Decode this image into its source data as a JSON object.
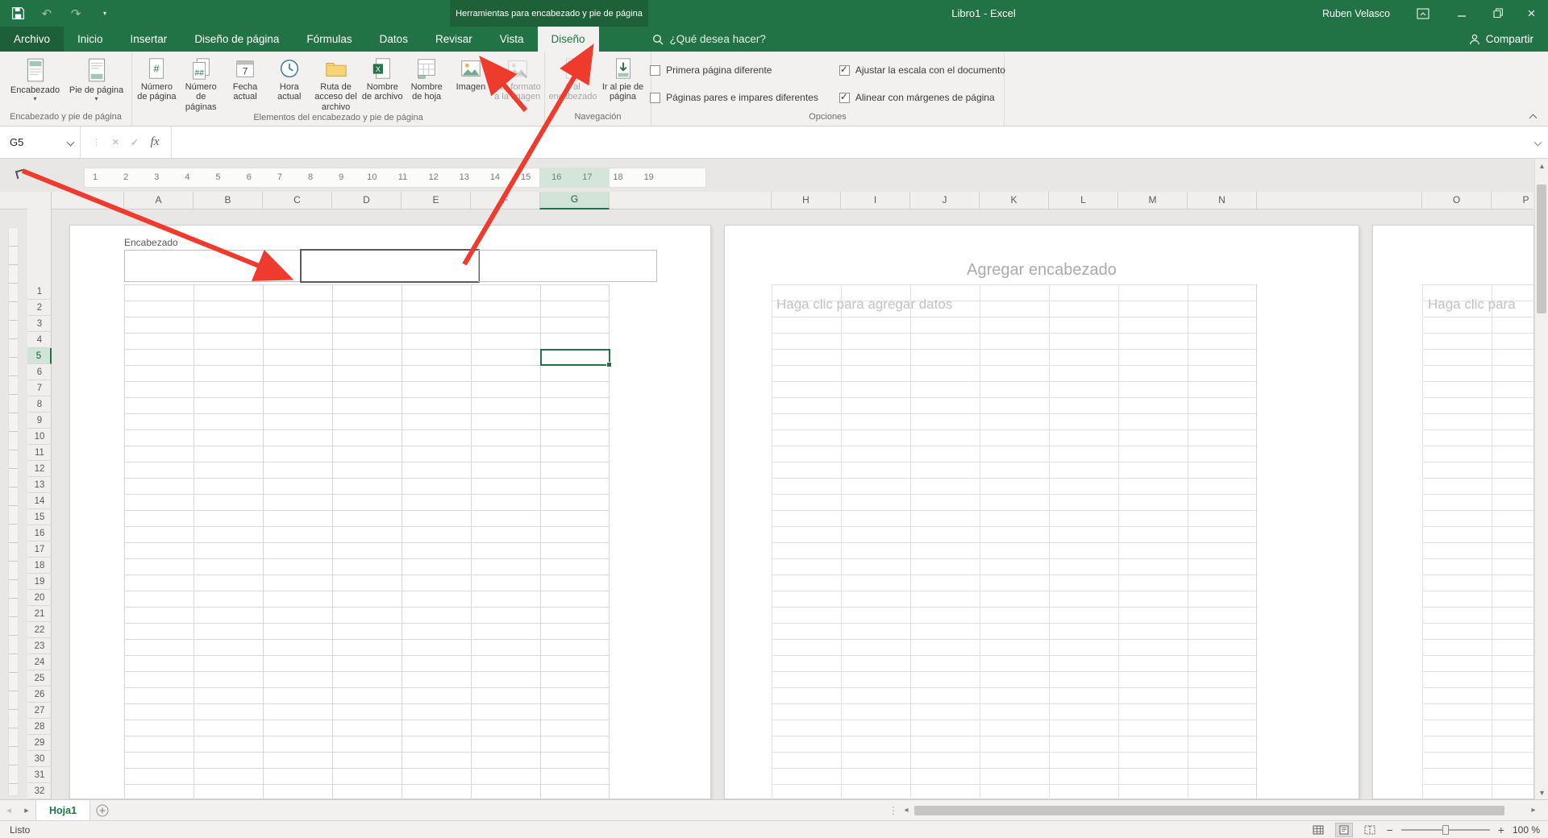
{
  "titlebar": {
    "contextual_title": "Herramientas para encabezado y pie de página",
    "document_title": "Libro1 - Excel",
    "user_name": "Ruben Velasco"
  },
  "tabs": {
    "file": "Archivo",
    "items": [
      "Inicio",
      "Insertar",
      "Diseño de página",
      "Fórmulas",
      "Datos",
      "Revisar",
      "Vista"
    ],
    "contextual": "Diseño",
    "search_text": "¿Qué desea hacer?",
    "share": "Compartir"
  },
  "ribbon": {
    "group1": {
      "title": "Encabezado y pie de página",
      "buttons": [
        {
          "label": "Encabezado",
          "icon": "header-icon"
        },
        {
          "label": "Pie de página",
          "icon": "footer-icon"
        }
      ]
    },
    "group2": {
      "title": "Elementos del encabezado y pie de página",
      "buttons": [
        {
          "label": "Número de página",
          "icon": "page-number-icon",
          "enabled": true
        },
        {
          "label": "Número de páginas",
          "icon": "number-of-pages-icon",
          "enabled": true
        },
        {
          "label": "Fecha actual",
          "icon": "current-date-icon",
          "enabled": true
        },
        {
          "label": "Hora actual",
          "icon": "current-time-icon",
          "enabled": true
        },
        {
          "label": "Ruta de acceso del archivo",
          "icon": "file-path-icon",
          "enabled": true
        },
        {
          "label": "Nombre de archivo",
          "icon": "file-name-icon",
          "enabled": true
        },
        {
          "label": "Nombre de hoja",
          "icon": "sheet-name-icon",
          "enabled": true
        },
        {
          "label": "Imagen",
          "icon": "picture-icon",
          "enabled": true
        },
        {
          "label": "Dar formato a la imagen",
          "icon": "format-picture-icon",
          "enabled": false
        }
      ]
    },
    "group3": {
      "title": "Navegación",
      "buttons": [
        {
          "label": "Ir al encabezado",
          "icon": "go-to-header-icon",
          "enabled": false
        },
        {
          "label": "Ir al pie de página",
          "icon": "go-to-footer-icon",
          "enabled": true
        }
      ]
    },
    "group4": {
      "title": "Opciones",
      "checkboxes": [
        {
          "label": "Primera página diferente",
          "checked": false
        },
        {
          "label": "Páginas pares e impares diferentes",
          "checked": false
        },
        {
          "label": "Ajustar la escala con el documento",
          "checked": true
        },
        {
          "label": "Alinear con márgenes de página",
          "checked": true
        }
      ]
    }
  },
  "formula_bar": {
    "name_box": "G5",
    "fx_label": "fx"
  },
  "ruler": {
    "numbers": [
      "1",
      "2",
      "3",
      "4",
      "5",
      "6",
      "7",
      "8",
      "9",
      "10",
      "11",
      "12",
      "13",
      "14",
      "15",
      "16",
      "17",
      "18",
      "19"
    ]
  },
  "sheet": {
    "columns_page1": [
      "A",
      "B",
      "C",
      "D",
      "E",
      "F",
      "G"
    ],
    "columns_page2": [
      "H",
      "I",
      "J",
      "K",
      "L",
      "M",
      "N"
    ],
    "columns_page3": [
      "O",
      "P"
    ],
    "selected_column": "G",
    "rows": 32,
    "selected_row": 5,
    "active_cell": "G5",
    "header_area_label": "Encabezado",
    "page2_header_placeholder": "Agregar encabezado",
    "page2_data_placeholder": "Haga clic para agregar datos",
    "page3_data_placeholder": "Haga clic para"
  },
  "sheet_tabs": {
    "active": "Hoja1"
  },
  "status_bar": {
    "status": "Listo",
    "zoom": "100 %"
  },
  "colors": {
    "excel_green": "#217346",
    "arrow_red": "#ee3b2e"
  }
}
